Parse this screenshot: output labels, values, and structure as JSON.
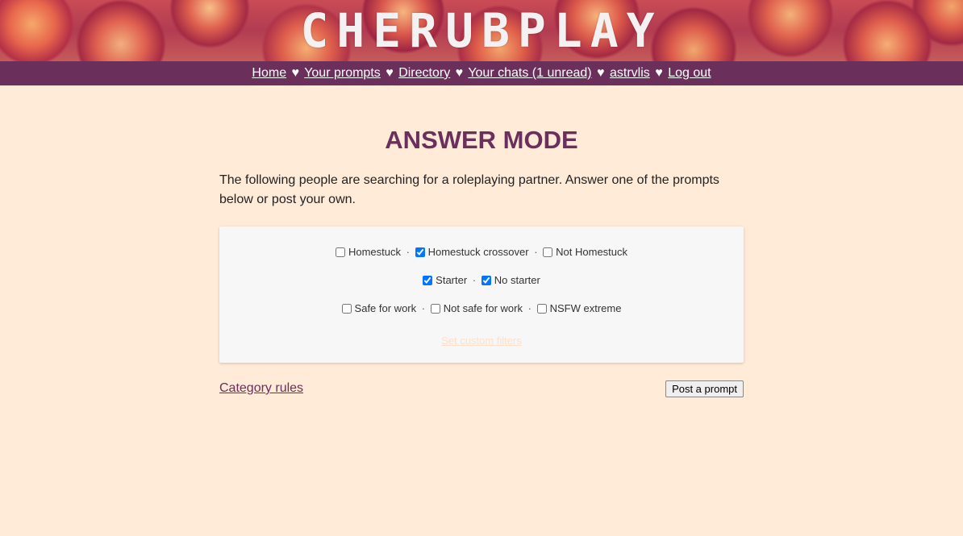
{
  "header": {
    "logo_text": "CHERUBPLAY"
  },
  "nav": {
    "items": [
      {
        "label": "Home"
      },
      {
        "label": "Your prompts"
      },
      {
        "label": "Directory"
      },
      {
        "label": "Your chats (1 unread)"
      },
      {
        "label": "astrvlis"
      },
      {
        "label": "Log out"
      }
    ],
    "separator": "♥"
  },
  "main": {
    "title": "ANSWER MODE",
    "intro": "The following people are searching for a roleplaying partner. Answer one of the prompts below or post your own."
  },
  "filters": {
    "rows": [
      [
        {
          "label": "Homestuck",
          "checked": false
        },
        {
          "label": "Homestuck crossover",
          "checked": true
        },
        {
          "label": "Not Homestuck",
          "checked": false
        }
      ],
      [
        {
          "label": "Starter",
          "checked": true
        },
        {
          "label": "No starter",
          "checked": true
        }
      ],
      [
        {
          "label": "Safe for work",
          "checked": false
        },
        {
          "label": "Not safe for work",
          "checked": false
        },
        {
          "label": "NSFW extreme",
          "checked": false
        }
      ]
    ],
    "dot": "·",
    "custom_filters_label": "Set custom filters"
  },
  "footer": {
    "category_rules_label": "Category rules",
    "post_prompt_label": "Post a prompt"
  },
  "colors": {
    "accent": "#6b2f5c",
    "background": "#ffebd8",
    "panel": "#f7f7f7"
  }
}
